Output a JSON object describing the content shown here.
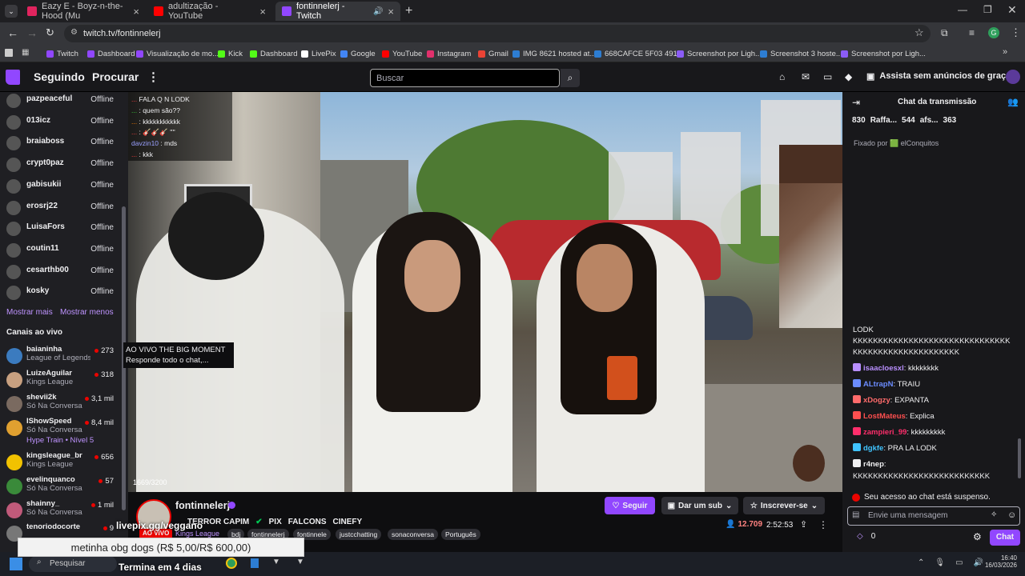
{
  "browser": {
    "tabs": [
      {
        "title": "Eazy E - Boyz-n-the-Hood (Mu",
        "color": "#e0245e"
      },
      {
        "title": "adultização - YouTube",
        "color": "#ff0000"
      },
      {
        "title": "fontinnelerj - Twitch",
        "color": "#9147ff"
      }
    ],
    "url": "twitch.tv/fontinnelerj",
    "bookmarks": [
      {
        "label": "Twitch",
        "color": "#9147ff"
      },
      {
        "label": "Dashboard",
        "color": "#9147ff"
      },
      {
        "label": "Visualização de mo...",
        "color": "#9147ff"
      },
      {
        "label": "Kick",
        "color": "#53fc18"
      },
      {
        "label": "Dashboard",
        "color": "#53fc18"
      },
      {
        "label": "LivePix",
        "color": "#ffffff"
      },
      {
        "label": "Google",
        "color": "#4285f4"
      },
      {
        "label": "YouTube",
        "color": "#ff0000"
      },
      {
        "label": "Instagram",
        "color": "#e1306c"
      },
      {
        "label": "Gmail",
        "color": "#ea4335"
      },
      {
        "label": "IMG 8621 hosted at...",
        "color": "#2d7dd2"
      },
      {
        "label": "668CAFCE 5F03 491...",
        "color": "#2d7dd2"
      },
      {
        "label": "Screenshot por Ligh...",
        "color": "#8b5cf6"
      },
      {
        "label": "Screenshot 3 hoste...",
        "color": "#2d7dd2"
      },
      {
        "label": "Screenshot por Ligh...",
        "color": "#8b5cf6"
      }
    ]
  },
  "nav": {
    "following": "Seguindo",
    "browse": "Procurar",
    "search_placeholder": "Buscar",
    "promo": "Assista sem anúncios de graça"
  },
  "sidebar": {
    "offline": [
      {
        "name": "pazpeaceful",
        "status": "Offline"
      },
      {
        "name": "013icz",
        "status": "Offline"
      },
      {
        "name": "braiaboss",
        "status": "Offline"
      },
      {
        "name": "crypt0paz",
        "status": "Offline"
      },
      {
        "name": "gabisukii",
        "status": "Offline"
      },
      {
        "name": "erosrj22",
        "status": "Offline"
      },
      {
        "name": "LuisaFors",
        "status": "Offline"
      },
      {
        "name": "coutin11",
        "status": "Offline"
      },
      {
        "name": "cesarthb00",
        "status": "Offline"
      },
      {
        "name": "kosky",
        "status": "Offline"
      }
    ],
    "show_more": "Mostrar mais",
    "show_less": "Mostrar menos",
    "live_header": "Canais ao vivo",
    "live": [
      {
        "name": "baianinha",
        "game": "League of Legends",
        "viewers": "273",
        "color": "#3b7bbf"
      },
      {
        "name": "LuizeAguilar",
        "game": "Kings League",
        "viewers": "318",
        "color": "#c8a080"
      },
      {
        "name": "shevii2k",
        "game": "Só Na Conversa",
        "viewers": "3,1 mil",
        "color": "#7a6a60"
      },
      {
        "name": "IShowSpeed",
        "game": "Só Na Conversa",
        "viewers": "8,4 mil",
        "color": "#e0a030"
      },
      {
        "name": "kingsleague_br",
        "game": "Kings League",
        "viewers": "656",
        "color": "#f2c200"
      },
      {
        "name": "evelinquanco",
        "game": "Só Na Conversa",
        "viewers": "57",
        "color": "#3a8a3a"
      },
      {
        "name": "shainny_",
        "game": "Só Na Conversa",
        "viewers": "1 mil",
        "color": "#c05a7a"
      },
      {
        "name": "tenoriodocorte",
        "game": "",
        "viewers": "9",
        "color": "#777"
      }
    ],
    "hype_train": "Hype Train • Nível 5",
    "tooltip": {
      "title": "AO VIVO THE BIG MOMENT",
      "desc": "Responde todo o chat,..."
    }
  },
  "video_overlay": {
    "chat_lines": [
      {
        "user": "...",
        "msg": "FALA Q N LODK",
        "color": "#ff4040"
      },
      {
        "user": "...",
        "msg": ": quem são??",
        "color": "#3ad13a"
      },
      {
        "user": "...",
        "msg": ": kkkkkkkkkkk",
        "color": "#ff7f00"
      },
      {
        "user": "...",
        "msg": ": 🎸🎸🎸 ''''",
        "color": "#ff4040"
      },
      {
        "user": "davzin10",
        "msg": ": mds",
        "color": "#9aa0ff"
      },
      {
        "user": "...",
        "msg": ": kkk",
        "color": "#ff4040"
      }
    ],
    "sub_goal": "1669/3200"
  },
  "stream": {
    "streamer": "fontinnelerj",
    "title_parts": [
      "TERROR CAPIM",
      "PIX",
      "FALCONS",
      "CINEFY"
    ],
    "category": "Kings League",
    "tags": [
      "bdj",
      "fontinnelerj",
      "fontinnele",
      "justcchatting",
      "sonaconversa",
      "Português"
    ],
    "follow": "Seguir",
    "gift_sub": "Dar um sub",
    "subscribe": "Inscrever-se",
    "viewers": "12.709",
    "uptime": "2:52:53",
    "livepix": "livepix.gg/veggano",
    "ao_vivo": "AO VIVO"
  },
  "chat": {
    "header": "Chat da transmissão",
    "leaderboard": [
      {
        "name": "830"
      },
      {
        "name": "Raffa...",
        "count": "544"
      },
      {
        "name": "afs...",
        "count": "363"
      }
    ],
    "pinned": "Fixado por 🟩 elConquitos",
    "messages": [
      {
        "user": "",
        "text": "LODK",
        "color": "#efeff1"
      },
      {
        "user": "",
        "text": "KKKKKKKKKKKKKKKKKKKKKKKKKKKKKKK",
        "color": "#efeff1"
      },
      {
        "user": "",
        "text": "KKKKKKKKKKKKKKKKKKKKK",
        "color": "#efeff1"
      },
      {
        "user": "isaacloesxl",
        "text": ": kkkkkkkk",
        "color": "#b98fff"
      },
      {
        "user": "ALtrapN",
        "text": ": TRAIU",
        "color": "#6b8cff"
      },
      {
        "user": "xDogzy",
        "text": ": EXPANTA",
        "color": "#ff6b6b"
      },
      {
        "user": "LostMateus",
        "text": ": Explica",
        "color": "#ff4f4f"
      },
      {
        "user": "zampieri_99",
        "text": ": kkkkkkkkk",
        "color": "#ff2e6b"
      },
      {
        "user": "dgkfe",
        "text": ": PRA LA LODK",
        "color": "#40c4ff"
      },
      {
        "user": "r4nep",
        "text": ":",
        "color": "#efeff1"
      },
      {
        "user": "",
        "text": "KKKKKKKKKKKKKKKKKKKKKKKKKKK",
        "color": "#efeff1"
      }
    ],
    "suspended": "Seu acesso ao chat está suspenso.",
    "input_placeholder": "Envie uma mensagem",
    "points": "0",
    "send": "Chat"
  },
  "overlays": {
    "ticker": "metinha obg dogs (R$ 5,00/R$ 600,00)",
    "ends_in": "Termina em 4 dias"
  },
  "taskbar": {
    "search": "Pesquisar",
    "time": "16:40",
    "date": "16/03/2026"
  }
}
